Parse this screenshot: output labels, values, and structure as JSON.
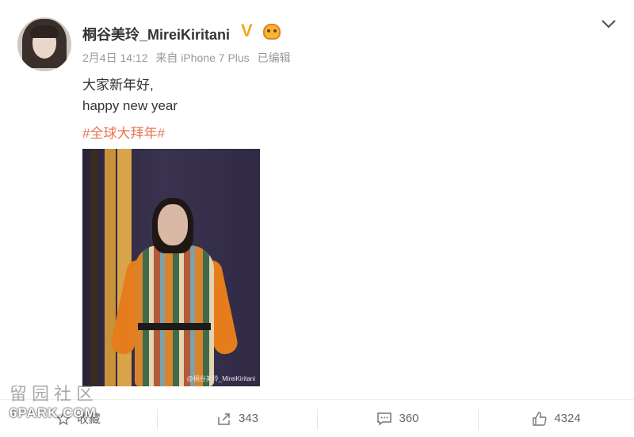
{
  "post": {
    "username": "桐谷美玲_MireiKiritani",
    "verified_badge": "V",
    "meta": {
      "date": "2月4日 14:12",
      "source": "来自 iPhone 7 Plus",
      "edited": "已编辑"
    },
    "text_line1": "大家新年好,",
    "text_line2": "happy new year",
    "hashtag": "#全球大拜年#",
    "image_watermark": "@桐谷美玲_MireiKiritani"
  },
  "actions": {
    "favorite_label": "收藏",
    "repost_count": "343",
    "comment_count": "360",
    "like_count": "4324"
  },
  "site_watermark": {
    "cn": "留园社区",
    "en": "6PARK.COM"
  },
  "colors": {
    "hashtag": "#eb7350",
    "verified": "#f5a623"
  }
}
